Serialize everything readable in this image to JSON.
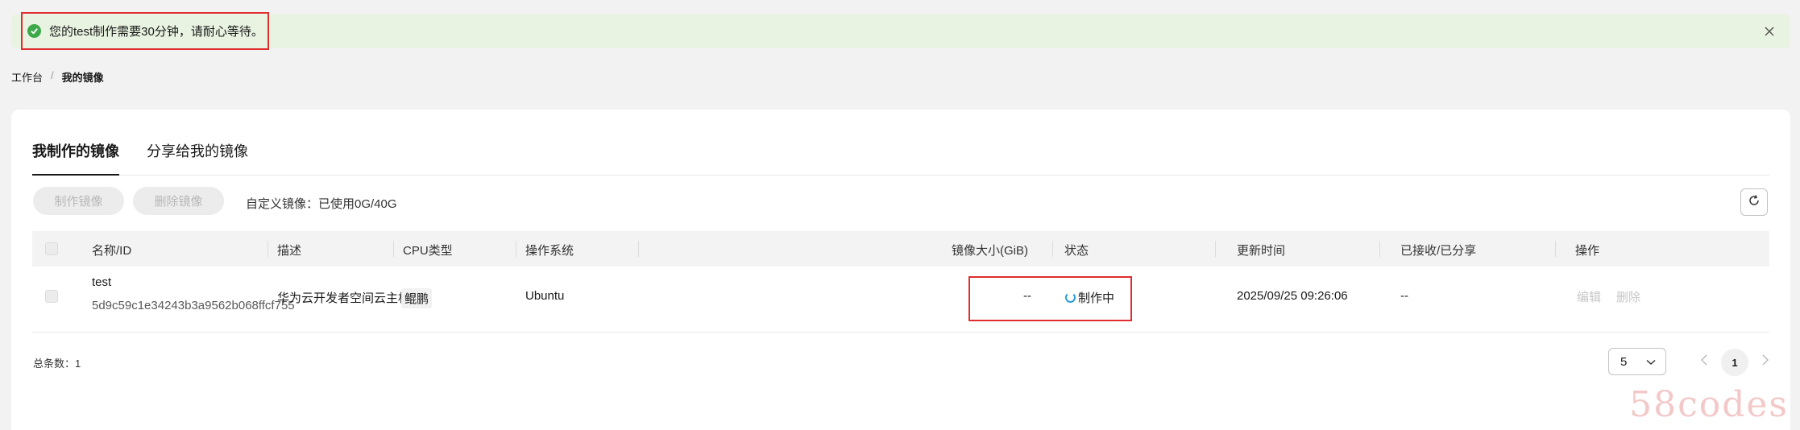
{
  "notice": {
    "text": "您的test制作需要30分钟，请耐心等待。"
  },
  "breadcrumb": {
    "parent": "工作台",
    "separator": "/",
    "current": "我的镜像"
  },
  "tabs": [
    {
      "label": "我制作的镜像",
      "active": true
    },
    {
      "label": "分享给我的镜像",
      "active": false
    }
  ],
  "toolbar": {
    "create_label": "制作镜像",
    "delete_label": "删除镜像",
    "quota": "自定义镜像：已使用0G/40G"
  },
  "table": {
    "columns": [
      "名称/ID",
      "描述",
      "CPU类型",
      "操作系统",
      "镜像大小(GiB)",
      "状态",
      "更新时间",
      "已接收/已分享",
      "操作"
    ],
    "rows": [
      {
        "name": "test",
        "id": "5d9c59c1e34243b3a9562b068ffcf755",
        "description": "华为云开发者空间云主机...",
        "cpu": "鲲鹏",
        "os": "Ubuntu",
        "size": "--",
        "status": "制作中",
        "updated": "2025/09/25 09:26:06",
        "shared": "--",
        "actions": {
          "edit": "编辑",
          "delete": "删除"
        }
      }
    ]
  },
  "footer": {
    "total": "总条数：1",
    "page_size": "5",
    "current_page": "1"
  },
  "watermark": "58codes",
  "colors": {
    "success": "#3ea94a",
    "highlight": "#e02d2d",
    "status": "#2b9bd6"
  }
}
